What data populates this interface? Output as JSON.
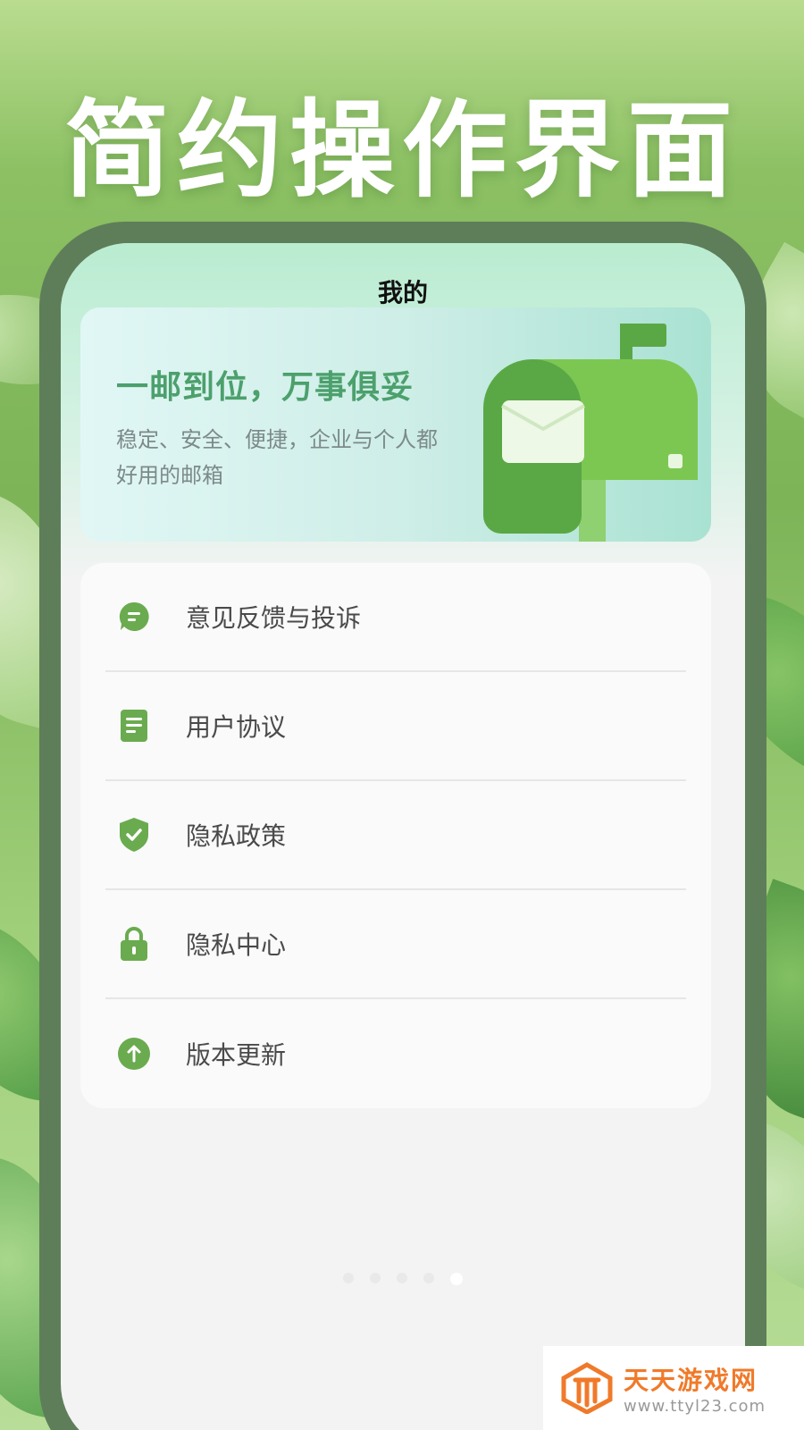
{
  "hero": {
    "title": "简约操作界面"
  },
  "screen": {
    "title": "我的"
  },
  "banner": {
    "headline": "一邮到位，万事俱妥",
    "subtitle": "稳定、安全、便捷，企业与个人都好用的邮箱"
  },
  "menu": {
    "items": [
      {
        "label": "意见反馈与投诉",
        "icon": "chat-bubble-icon"
      },
      {
        "label": "用户协议",
        "icon": "document-icon"
      },
      {
        "label": "隐私政策",
        "icon": "shield-check-icon"
      },
      {
        "label": "隐私中心",
        "icon": "lock-icon"
      },
      {
        "label": "版本更新",
        "icon": "arrow-up-circle-icon"
      }
    ]
  },
  "pager": {
    "count": 5,
    "active_index": 4
  },
  "watermark": {
    "name": "天天游戏网",
    "url": "www.ttyl23.com"
  },
  "colors": {
    "accent": "#6aab4f",
    "headline": "#4ca06c",
    "frame": "#5e7e5a"
  }
}
